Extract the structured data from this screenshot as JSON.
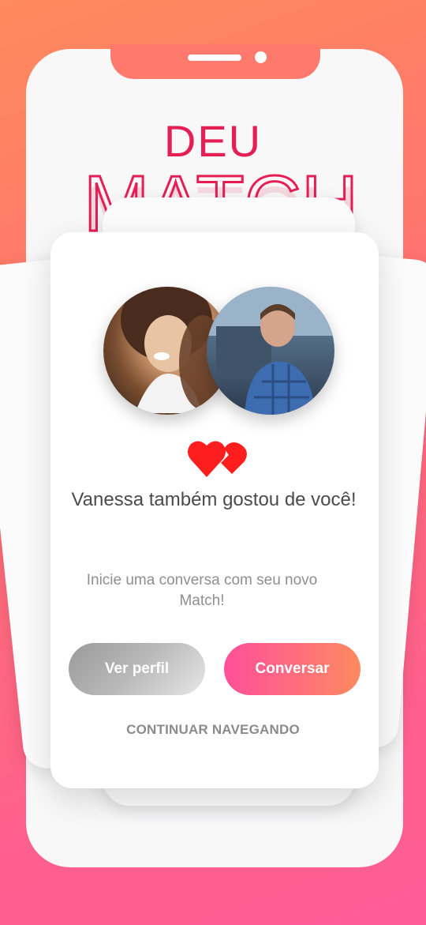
{
  "header": {
    "deu": "DEU",
    "match": "MATCH"
  },
  "profiles": {
    "her": {
      "icon": "woman-photo"
    },
    "him": {
      "icon": "man-photo"
    }
  },
  "match_message": "Vanessa também gostou de você!",
  "subtitle": "Inicie uma conversa com seu novo Match!",
  "buttons": {
    "ver_perfil": "Ver perfil",
    "conversar": "Conversar"
  },
  "continue_label": "CONTINUAR NAVEGANDO",
  "colors": {
    "accent": "#e51e54",
    "heart": "#ff1e1e"
  }
}
